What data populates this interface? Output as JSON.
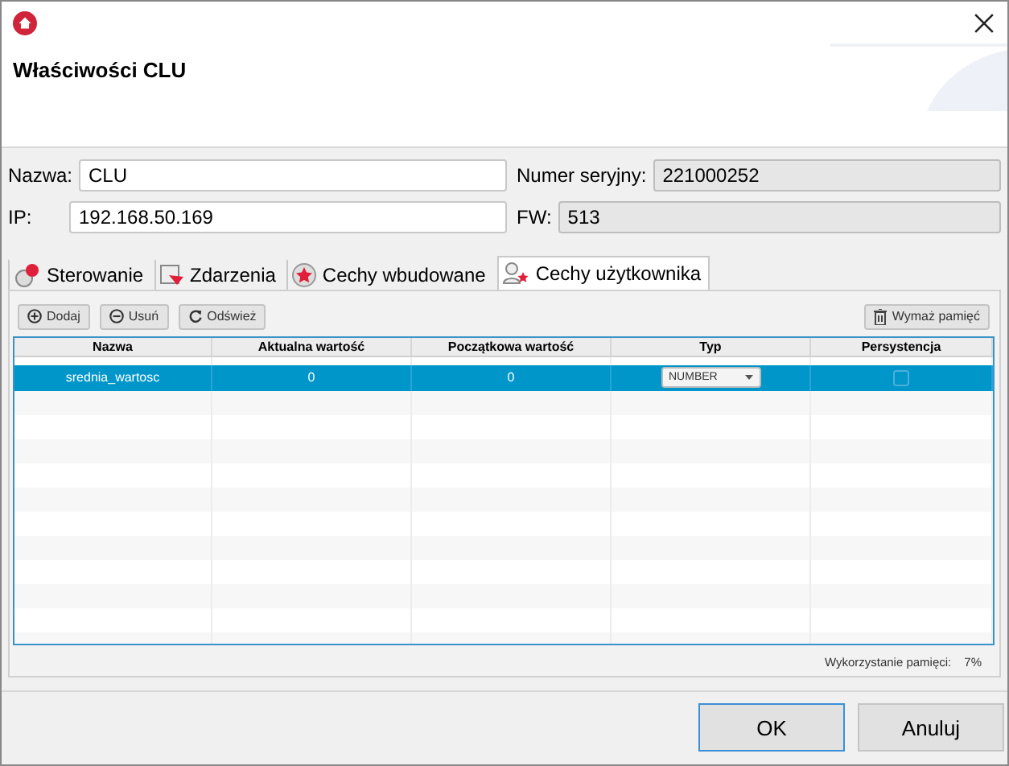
{
  "window": {
    "title": "Właściwości CLU"
  },
  "fields": [
    {
      "label": "Nazwa:",
      "value": "CLU",
      "readonly": false
    },
    {
      "label": "Numer seryjny:",
      "value": "221000252",
      "readonly": true
    },
    {
      "label": "IP:",
      "value": "192.168.50.169",
      "readonly": false
    },
    {
      "label": "FW:",
      "value": "513",
      "readonly": true
    }
  ],
  "tabs": [
    {
      "label": "Sterowanie",
      "selected": false
    },
    {
      "label": "Zdarzenia",
      "selected": false
    },
    {
      "label": "Cechy wbudowane",
      "selected": false
    },
    {
      "label": "Cechy użytkownika",
      "selected": true
    }
  ],
  "toolbar": [
    "Dodaj",
    "Usuń",
    "Odśwież"
  ],
  "clear_button": "Wymaż pamięć",
  "table": {
    "columns": [
      "Nazwa",
      "Aktualna wartość",
      "Początkowa wartość",
      "Typ",
      "Persystencja"
    ],
    "rows": [
      {
        "name": "srednia_wartosc",
        "current": "0",
        "initial": "0",
        "type": "NUMBER",
        "persistent": false,
        "selected": true
      }
    ]
  },
  "memory_usage": {
    "label": "Wykorzystanie pamięci:",
    "value": "7%"
  },
  "buttons": [
    "OK",
    "Anuluj"
  ]
}
